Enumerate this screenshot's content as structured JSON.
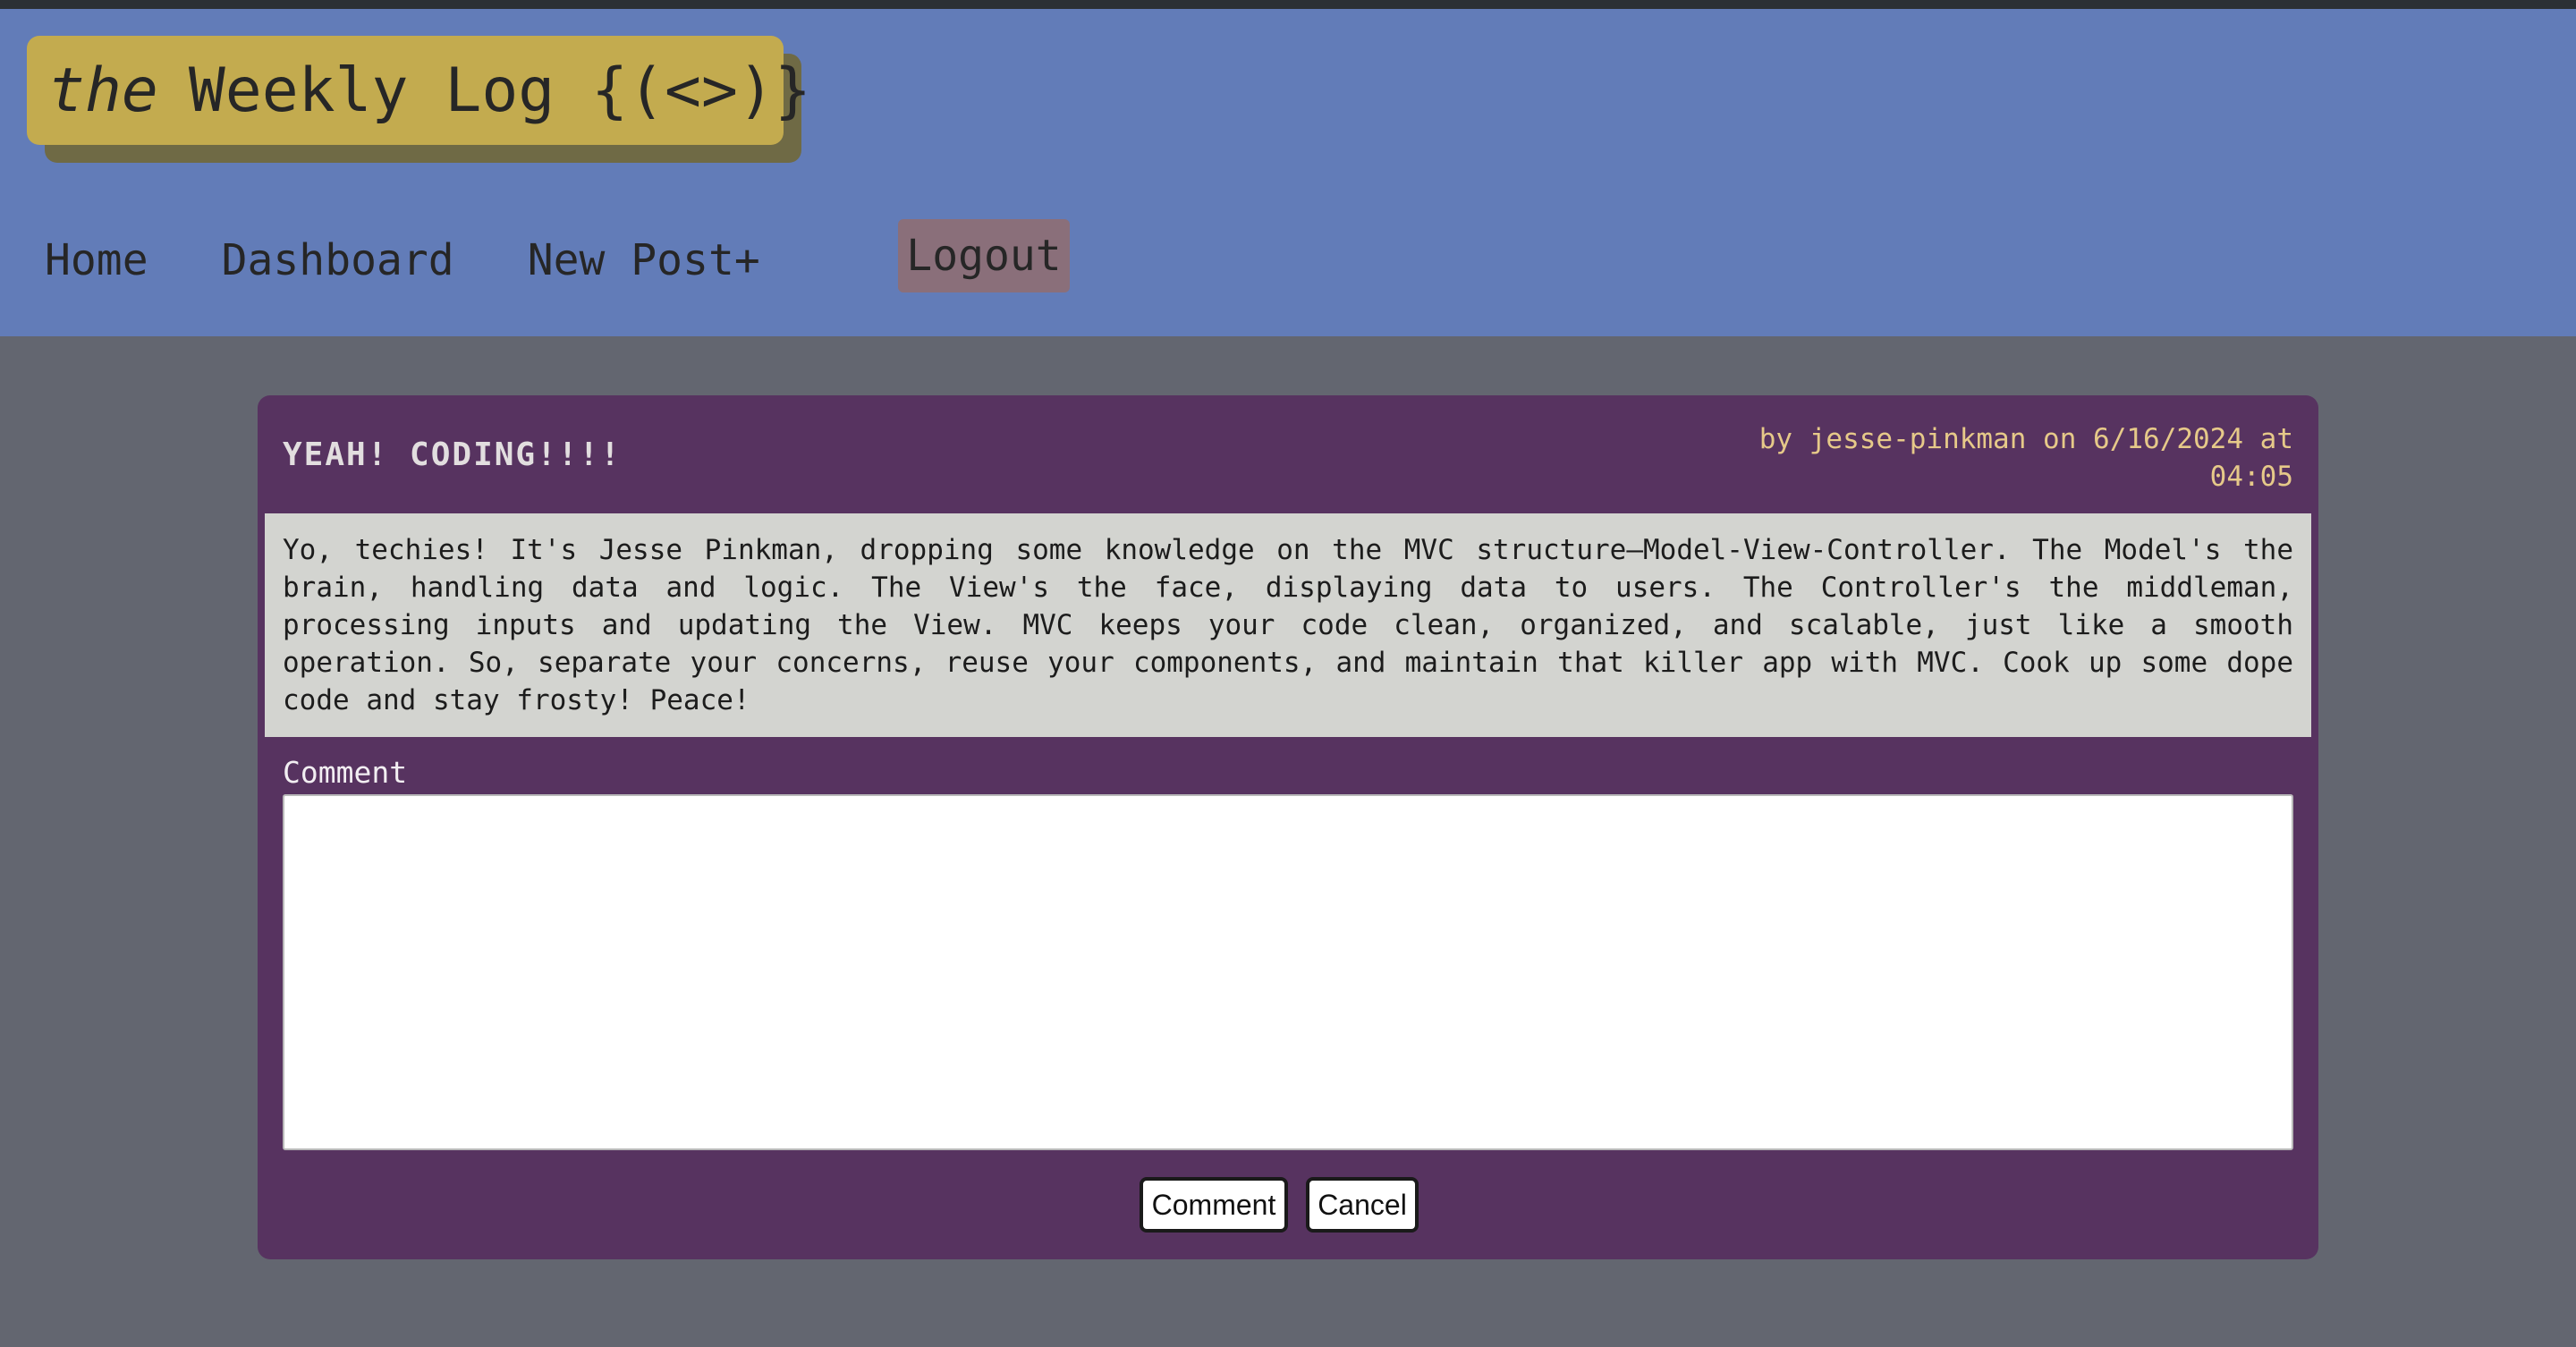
{
  "header": {
    "logo_prefix": "the",
    "logo_main": "Weekly Log {(<>)}",
    "nav": {
      "home": "Home",
      "dashboard": "Dashboard",
      "new_post": "New Post+",
      "logout": "Logout"
    }
  },
  "post": {
    "title": "YEAH! CODING!!!!",
    "meta": "by jesse-pinkman on 6/16/2024 at 04:05",
    "body": "Yo, techies! It's Jesse Pinkman, dropping some knowledge on the MVC structure—Model-View-Controller. The Model's the brain, handling data and logic. The View's the face, displaying data to users. The Controller's the middleman, processing inputs and updating the View. MVC keeps your code clean, organized, and scalable, just like a smooth operation. So, separate your concerns, reuse your components, and maintain that killer app with MVC. Cook up some dope code and stay frosty! Peace!"
  },
  "comment_form": {
    "label": "Comment",
    "value": "",
    "submit_label": "Comment",
    "cancel_label": "Cancel"
  },
  "colors": {
    "header_bg": "#627cb8",
    "logo_bg": "#c3ab4f",
    "logout_bg": "#8a6f7a",
    "page_bg": "#636670",
    "card_bg": "#573360",
    "meta_text": "#e6c989",
    "post_body_bg": "#d3d4d0"
  }
}
